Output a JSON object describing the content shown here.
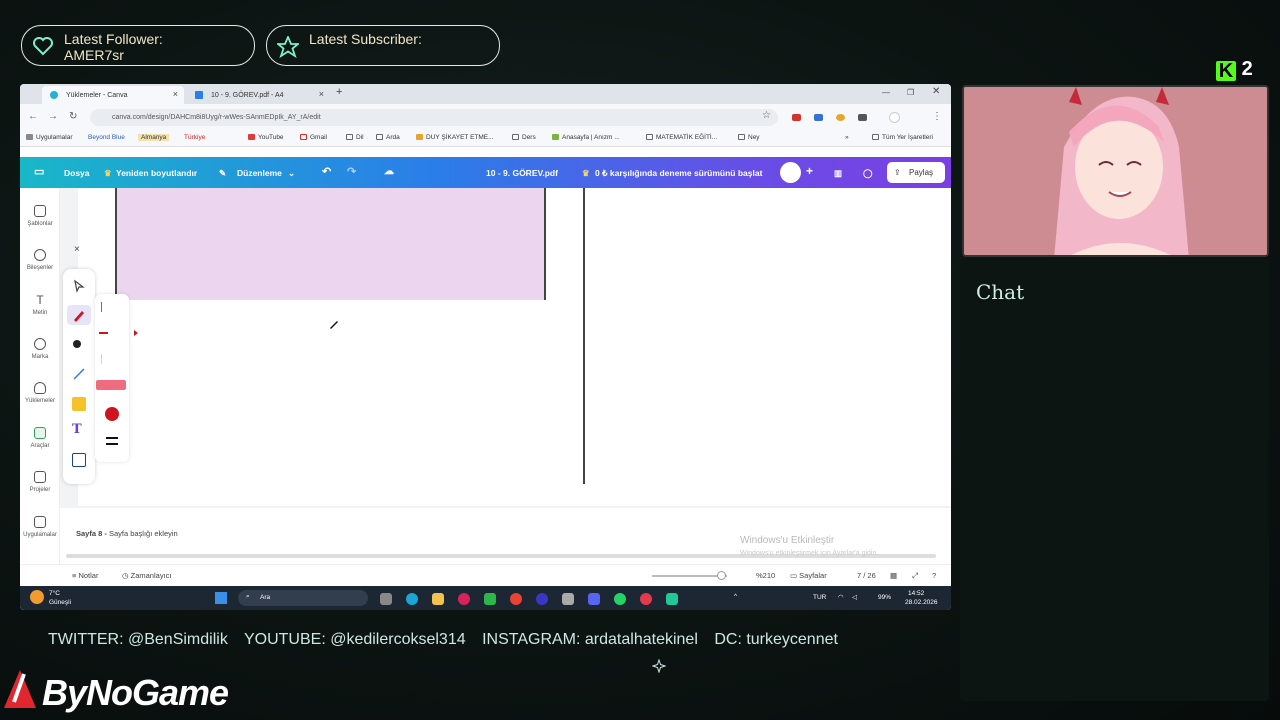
{
  "alerts": {
    "follower_label": "Latest Follower:",
    "follower_name": "AMER7sr",
    "subscriber_label": "Latest Subscriber:"
  },
  "browser": {
    "tabs": [
      {
        "label": "Yüklemeler - Canva",
        "active": true
      },
      {
        "label": "10 - 9. GÖREV.pdf - A4",
        "active": false
      }
    ],
    "new_tab": "+",
    "url": "canva.com/design/DAHCm8i8Uyg/r-wWes-SAnmEDpIk_AY_rA/edit",
    "bookmarks": [
      "Uygulamalar",
      "Beyond Blue",
      "Almanya",
      "Türkiye",
      "YouTube",
      "Gmail",
      "Dil",
      "Arda",
      "DUY ŞİKAYET ETME...",
      "Ders",
      "Anasayfa | Anızm ...",
      "MATEMATİK EĞİTİ...",
      "Ney",
      "Tüm Yer İşaretleri"
    ],
    "bookmark_overflow": "»"
  },
  "canva": {
    "file_menu": "Dosya",
    "resize": "Yeniden boyutlandır",
    "edit_mode": "Düzenleme",
    "doc_title": "10 - 9. GÖREV.pdf",
    "trial": "0 ₺ karşılığında deneme sürümünü başlat",
    "share": "Paylaş",
    "rail": [
      "Şablonlar",
      "Bileşenler",
      "Metin",
      "Marka",
      "Yüklemeler",
      "Araçlar",
      "Projeler",
      "Uygulamalar"
    ],
    "page_label_prefix": "Sayfa 8 - ",
    "page_label_placeholder": "Sayfa başlığı ekleyin",
    "notes": "Notlar",
    "timer": "Zamanlayıcı",
    "zoom": "%210",
    "pages": "Sayfalar",
    "page_count": "7 / 26",
    "close_panel": "×",
    "zoom_level": 0.92
  },
  "windows": {
    "activate_title": "Windows'u Etkinleştir",
    "activate_sub": "Windows'u etkinleştirmek için Ayarlar'a gidin.",
    "weather_temp": "7°C",
    "weather_city": "Güneşli",
    "search": "Ara",
    "lang": "TUR",
    "battery": "99%",
    "time": "14:52",
    "date": "28.02.2026"
  },
  "stream": {
    "chat_title": "Chat",
    "kick_count": "2",
    "socials": [
      "TWITTER: @BenSimdilik",
      "YOUTUBE: @kedilercoksel314",
      "INSTAGRAM: ardatalhatekinel",
      "DC: turkeycennet"
    ],
    "brand": "ByNoGame"
  },
  "colors": {
    "canva_gradient_start": "#19b7c8",
    "canva_gradient_end": "#7b3fe4",
    "purple_block": "#ecd6ef",
    "pen_red": "#d0141f"
  }
}
